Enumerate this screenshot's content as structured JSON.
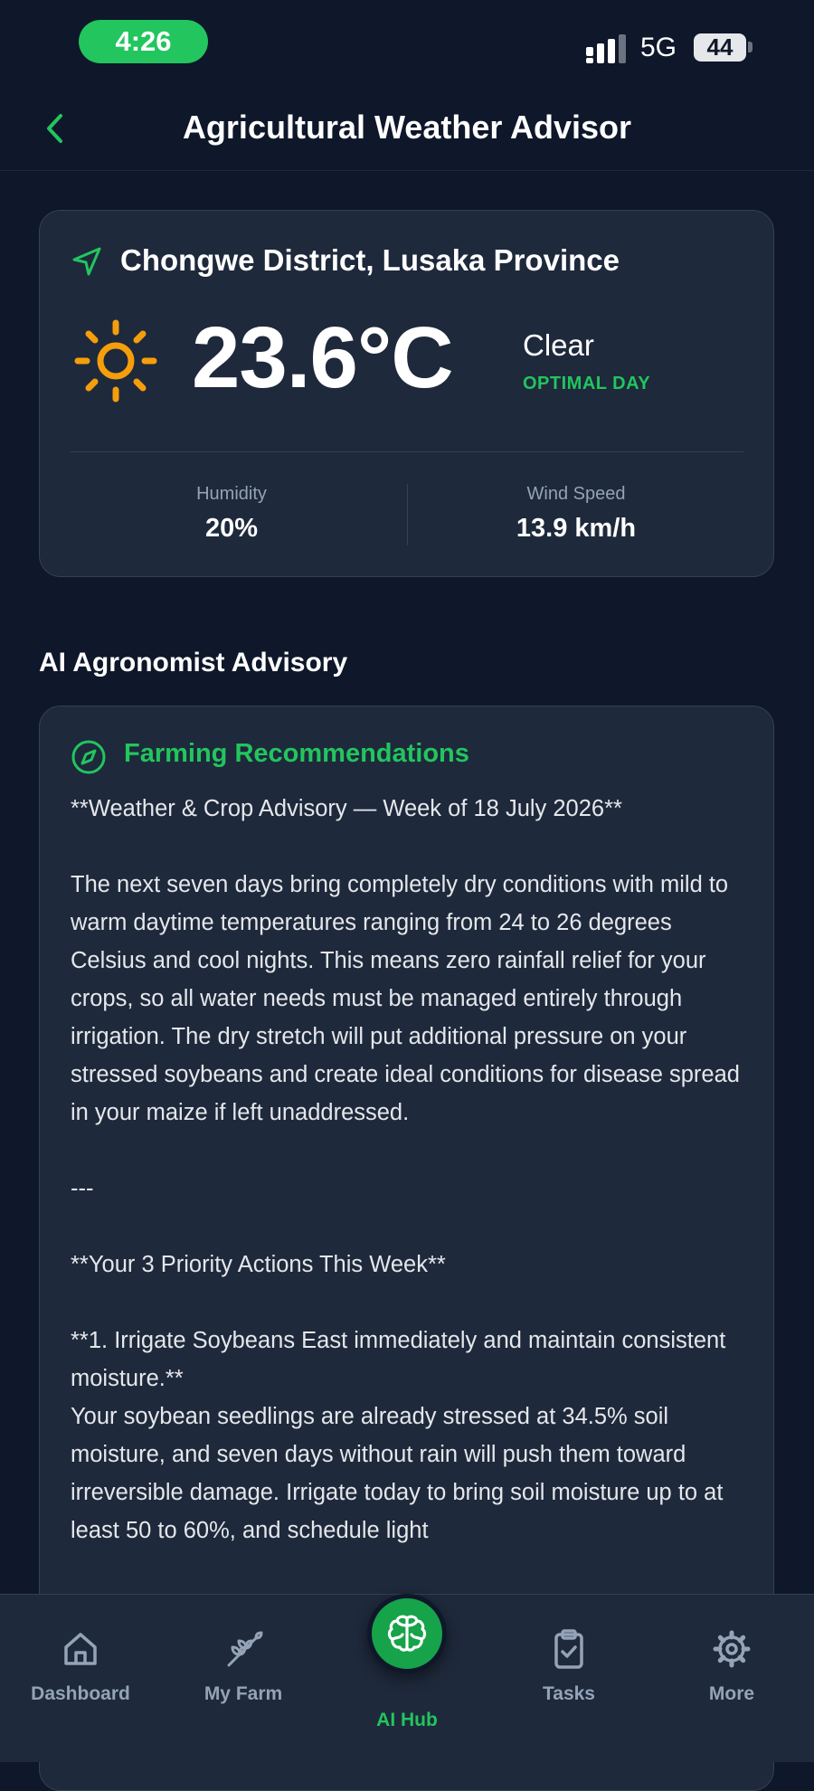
{
  "status_bar": {
    "time": "4:26",
    "network": "5G",
    "battery": "44"
  },
  "header": {
    "title": "Agricultural Weather Advisor"
  },
  "weather": {
    "location": "Chongwe District, Lusaka Province",
    "temperature": "23.6°C",
    "condition": "Clear",
    "day_status": "OPTIMAL DAY",
    "humidity_label": "Humidity",
    "humidity_value": "20%",
    "wind_label": "Wind Speed",
    "wind_value": "13.9 km/h"
  },
  "advisory": {
    "section_title": "AI Agronomist Advisory",
    "card_title": "Farming Recommendations",
    "body": "**Weather & Crop Advisory — Week of 18 July 2026**\n\nThe next seven days bring completely dry conditions with mild to warm daytime temperatures ranging from 24 to 26 degrees Celsius and cool nights. This means zero rainfall relief for your crops, so all water needs must be managed entirely through irrigation. The dry stretch will put additional pressure on your stressed soybeans and create ideal conditions for disease spread in your maize if left unaddressed.\n\n---\n\n**Your 3 Priority Actions This Week**\n\n**1. Irrigate Soybeans East immediately and maintain consistent moisture.**\nYour soybean seedlings are already stressed at 34.5% soil moisture, and seven days without rain will push them toward irreversible damage. Irrigate today to bring soil moisture up to at least 50 to 60%, and schedule light"
  },
  "nav": {
    "dashboard": "Dashboard",
    "my_farm": "My Farm",
    "ai_hub": "AI Hub",
    "tasks": "Tasks",
    "more": "More"
  },
  "colors": {
    "background": "#0f172a",
    "card": "#1e293b",
    "accent_green": "#22c55e",
    "sun": "#f59e0b",
    "muted": "#94a3b8"
  }
}
